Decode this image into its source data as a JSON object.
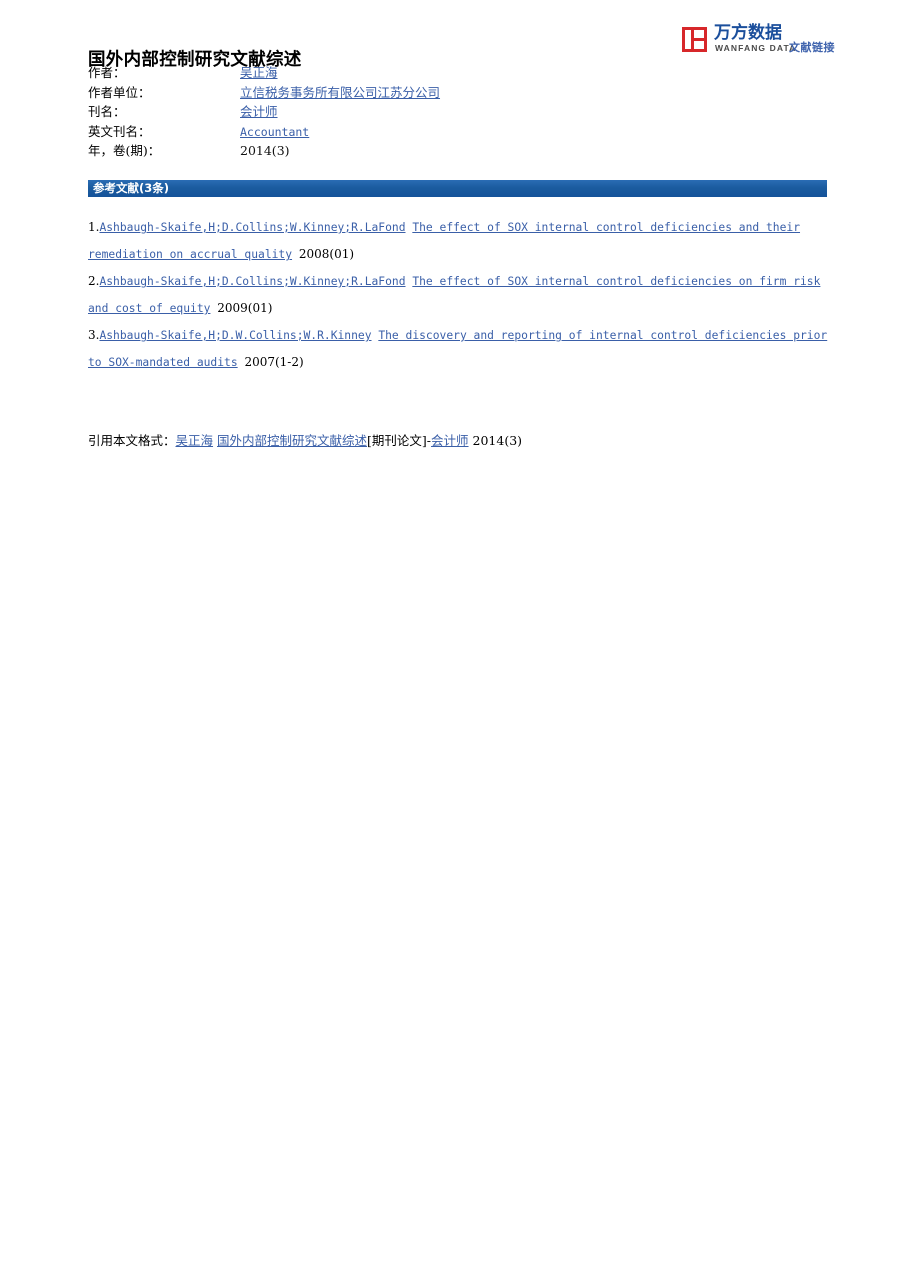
{
  "logo": {
    "mark_color": "#d7272a",
    "cn_name": "万方数据",
    "en_name": "WANFANG DATA",
    "tagline": "文献链接"
  },
  "document": {
    "title": "国外内部控制研究文献综述"
  },
  "metadata": {
    "rows": [
      {
        "label": "作者：",
        "value": "吴正海",
        "style": "link"
      },
      {
        "label": "作者单位：",
        "value": "立信税务事务所有限公司江苏分公司",
        "style": "link"
      },
      {
        "label": "刊名：",
        "value": "会计师",
        "style": "link"
      },
      {
        "label": "英文刊名：",
        "value": "Accountant",
        "style": "mono-link"
      },
      {
        "label": "年，卷(期)：",
        "value": "2014(3)",
        "style": "plain"
      }
    ]
  },
  "references_section": {
    "heading": "参考文献(3条)",
    "accent_color": "#1d5fa4",
    "items": [
      {
        "number": "1.",
        "authors": "Ashbaugh-Skaife,H;D.Collins;W.Kinney;R.LaFond",
        "title": "The effect of SOX internal control deficiencies and their remediation on accrual quality",
        "year": "2008(01)"
      },
      {
        "number": "2.",
        "authors": "Ashbaugh-Skaife,H;D.Collins;W.Kinney;R.LaFond",
        "title": "The effect of SOX internal control deficiencies on firm risk and cost of equity",
        "year": "2009(01)"
      },
      {
        "number": "3.",
        "authors": "Ashbaugh-Skaife,H;D.W.Collins;W.R.Kinney",
        "title": "The discovery and reporting of internal control deficiencies prior to SOX-mandated audits",
        "year": "2007(1-2)"
      }
    ]
  },
  "citation": {
    "prefix": "引用本文格式：",
    "author": "吴正海",
    "title": "国外内部控制研究文献综述",
    "type": "[期刊论文]-",
    "journal": "会计师",
    "year": "2014(3)"
  },
  "colors": {
    "link": "#3a5fa8",
    "bar": "#1d5fa4",
    "logo_red": "#d7272a"
  }
}
